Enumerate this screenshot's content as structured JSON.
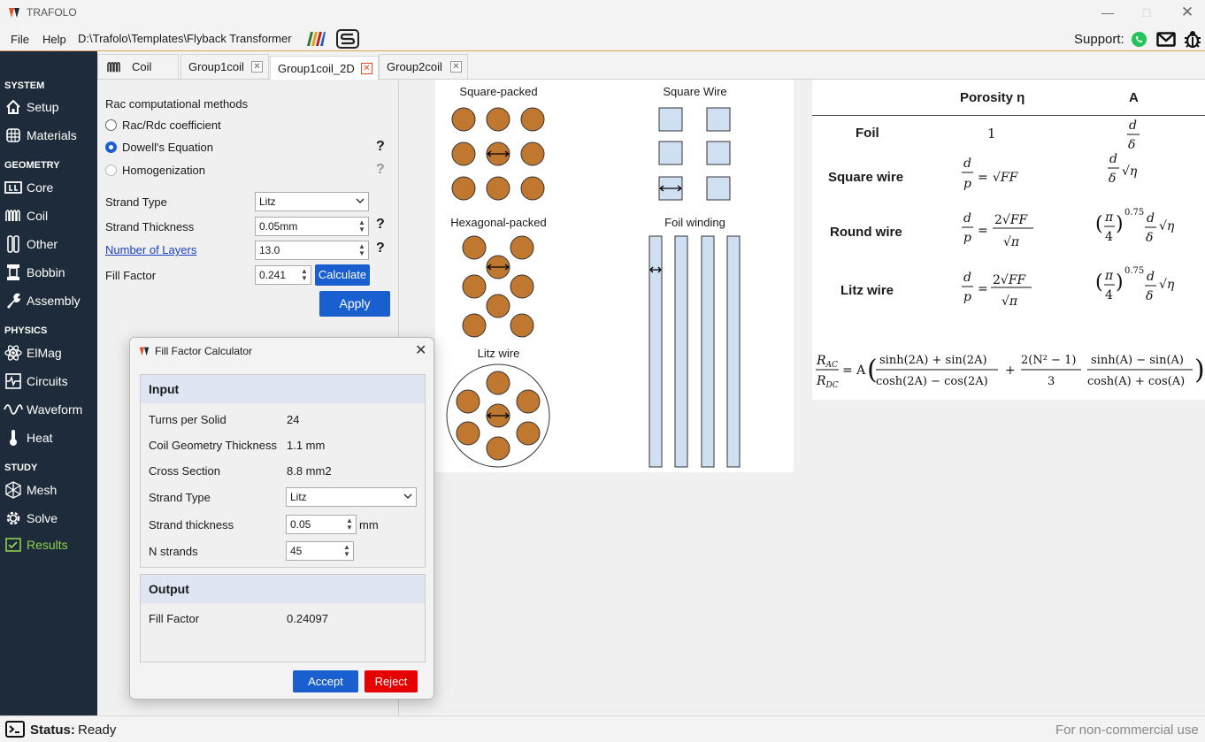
{
  "app": {
    "title": "TRAFOLO"
  },
  "menu": {
    "file": "File",
    "help": "Help",
    "path": "D:\\Trafolo\\Templates\\Flyback Transformer",
    "support": "Support:"
  },
  "sidebar": {
    "sections": [
      "SYSTEM",
      "GEOMETRY",
      "PHYSICS",
      "STUDY"
    ],
    "items": [
      {
        "label": "Setup",
        "icon": "home-icon"
      },
      {
        "label": "Materials",
        "icon": "grid-globe-icon"
      },
      {
        "label": "Core",
        "icon": "core-icon"
      },
      {
        "label": "Coil",
        "icon": "coil-icon"
      },
      {
        "label": "Other",
        "icon": "other-icon"
      },
      {
        "label": "Bobbin",
        "icon": "bobbin-icon"
      },
      {
        "label": "Assembly",
        "icon": "wrench-icon"
      },
      {
        "label": "ElMag",
        "icon": "atom-icon"
      },
      {
        "label": "Circuits",
        "icon": "circuit-icon"
      },
      {
        "label": "Waveform",
        "icon": "wave-icon"
      },
      {
        "label": "Heat",
        "icon": "thermometer-icon"
      },
      {
        "label": "Mesh",
        "icon": "mesh-cube-icon"
      },
      {
        "label": "Solve",
        "icon": "gear-icon"
      },
      {
        "label": "Results",
        "icon": "results-check-icon"
      }
    ],
    "active_color": "#8fd14f"
  },
  "tabs": [
    {
      "label": "Coil"
    },
    {
      "label": "Group1coil"
    },
    {
      "label": "Group1coil_2D"
    },
    {
      "label": "Group2coil"
    }
  ],
  "rac": {
    "heading": "Rac computational methods",
    "options": [
      "Rac/Rdc coefficient",
      "Dowell's Equation",
      "Homogenization"
    ],
    "selected": "Dowell's Equation",
    "q": "?"
  },
  "strand": {
    "type_label": "Strand Type",
    "type_value": "Litz",
    "thickness_label": "Strand Thickness",
    "thickness_value": "0.05mm",
    "layers_label": "Number of Layers",
    "layers_value": "13.0",
    "fill_label": "Fill Factor",
    "fill_value": "0.241",
    "calculate": "Calculate",
    "apply": "Apply"
  },
  "diagram": {
    "square_packed": "Square-packed",
    "square_wire": "Square Wire",
    "hexagonal_packed": "Hexagonal-packed",
    "foil_winding": "Foil winding",
    "litz_wire": "Litz wire"
  },
  "formulas": {
    "col_porosity": "Porosity η",
    "col_a": "A",
    "rows": [
      "Foil",
      "Square wire",
      "Round wire",
      "Litz wire"
    ],
    "foil_porosity": "1"
  },
  "status": {
    "label": "Status:",
    "value": "Ready",
    "note": "For non-commercial use"
  },
  "dialog": {
    "title": "Fill Factor Calculator",
    "input_head": "Input",
    "turns_label": "Turns per Solid",
    "turns_value": "24",
    "cgt_label": "Coil Geometry Thickness",
    "cgt_value": "1.1 mm",
    "cs_label": "Cross Section",
    "cs_value": "8.8 mm2",
    "st_label": "Strand Type",
    "st_value": "Litz",
    "sth_label": "Strand thickness",
    "sth_value": "0.05",
    "sth_unit": "mm",
    "n_label": "N strands",
    "n_value": "45",
    "output_head": "Output",
    "ff_label": "Fill Factor",
    "ff_value": "0.24097",
    "accept": "Accept",
    "reject": "Reject"
  },
  "colors": {
    "accent": "#1a5fd0",
    "reject": "#e60000",
    "sidebar": "#1e2b3a",
    "copper": "#c07830",
    "square_fill": "#cfe0f3"
  }
}
